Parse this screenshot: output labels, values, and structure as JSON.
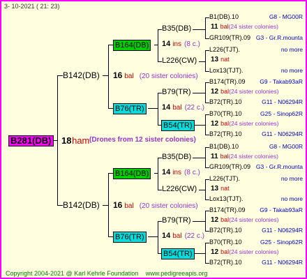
{
  "header": {
    "date": "3- 10-2021 ( 21: 23)"
  },
  "colors": {
    "border": "#ff00ff",
    "background": "#ffffe0",
    "magenta_box": "#ff00ff",
    "green_box": "#00cc00",
    "cyan_box": "#00dddd",
    "red": "#cc0000",
    "purple": "#9933cc",
    "blue": "#0000cc"
  },
  "root": {
    "id": "B281(DB)",
    "year": "18",
    "race": "ham",
    "note": "(Drones from 12 sister colonies)"
  },
  "gen1": [
    {
      "id": "B142(DB)",
      "year": "16",
      "race": "bal",
      "note": "(20 sister colonies)"
    },
    {
      "id": "B142(DB)",
      "year": "16",
      "race": "bal",
      "note": "(20 sister colonies)"
    }
  ],
  "gen2": [
    {
      "id": "B164(DB)",
      "year": "14",
      "race": "ins",
      "note": "(8 c.)"
    },
    {
      "id": "B76(TR)",
      "year": "14",
      "race": "bal",
      "note": "(22 c.)"
    },
    {
      "id": "B164(DB)",
      "year": "14",
      "race": "ins",
      "note": "(8 c.)"
    },
    {
      "id": "B76(TR)",
      "year": "14",
      "race": "bal",
      "note": "(22 c.)"
    }
  ],
  "gen3": [
    {
      "id": "B35(DB)"
    },
    {
      "id": "L226(CW)"
    },
    {
      "id": "B79(TR)"
    },
    {
      "id": "B54(TR)"
    },
    {
      "id": "B35(DB)"
    },
    {
      "id": "L226(CW)"
    },
    {
      "id": "B79(TR)"
    },
    {
      "id": "B54(TR)"
    }
  ],
  "gen4": [
    {
      "id": "B1(DB).10",
      "ref": "G8 - MG00R"
    },
    {
      "year": "11",
      "race": "bal",
      "note": "(24 sister colonies)"
    },
    {
      "id": "GR109(TR).09",
      "ref": "G3 - Gr.R.mounta"
    },
    {
      "id": "L226(TJT).",
      "ref": "no more"
    },
    {
      "year": "13",
      "race": "nat"
    },
    {
      "id": "Lox13(TJT).",
      "ref": "no more"
    },
    {
      "id": "B174(TR).09",
      "ref": "G9 - Takab93aR"
    },
    {
      "year": "12",
      "race": "bal",
      "note": "(24 sister colonies)"
    },
    {
      "id": "B72(TR).10",
      "ref": "G11 - N06294R"
    },
    {
      "id": "B70(TR).10",
      "ref": "G25 - Sinop62R"
    },
    {
      "year": "12",
      "race": "bal",
      "note": "(24 sister colonies)"
    },
    {
      "id": "B72(TR).10",
      "ref": "G11 - N06294R"
    },
    {
      "id": "B1(DB).10",
      "ref": "G8 - MG00R"
    },
    {
      "year": "11",
      "race": "bal",
      "note": "(24 sister colonies)"
    },
    {
      "id": "GR109(TR).09",
      "ref": "G3 - Gr.R.mounta"
    },
    {
      "id": "L226(TJT).",
      "ref": "no more"
    },
    {
      "year": "13",
      "race": "nat"
    },
    {
      "id": "Lox13(TJT).",
      "ref": "no more"
    },
    {
      "id": "B174(TR).09",
      "ref": "G9 - Takab93aR"
    },
    {
      "year": "12",
      "race": "bal",
      "note": "(24 sister colonies)"
    },
    {
      "id": "B72(TR).10",
      "ref": "G11 - N06294R"
    },
    {
      "id": "B70(TR).10",
      "ref": "G25 - Sinop62R"
    },
    {
      "year": "12",
      "race": "bal",
      "note": "(24 sister colonies)"
    },
    {
      "id": "B72(TR).10",
      "ref": "G11 - N06294R"
    }
  ],
  "footer": {
    "copyright": "Copyright 2004-2021 @ Karl Kehrle Foundation",
    "site": "www.pedigreeapis.org"
  }
}
